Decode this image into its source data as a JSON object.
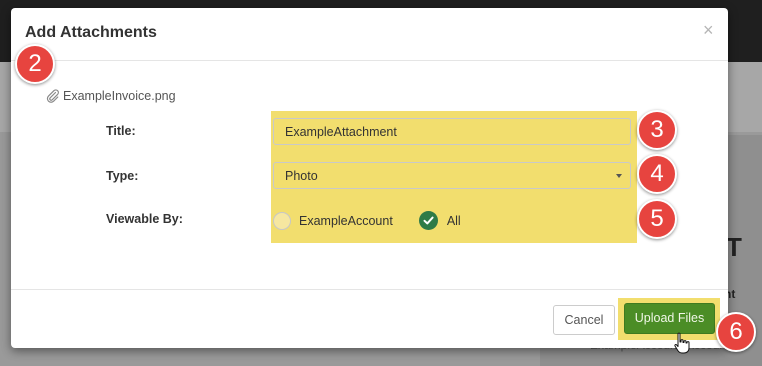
{
  "background": {
    "partial_heading": "T",
    "partial_label": "nt",
    "partial_text": "ExampleAccount, Account"
  },
  "dialog": {
    "title": "Add Attachments",
    "close_glyph": "×",
    "attached_file": "ExampleInvoice.png",
    "fields": {
      "title_label": "Title:",
      "title_value": "ExampleAttachment",
      "type_label": "Type:",
      "type_value": "Photo",
      "viewable_label": "Viewable By:",
      "viewable_options": [
        {
          "label": "ExampleAccount",
          "checked": false
        },
        {
          "label": "All",
          "checked": true
        }
      ]
    },
    "buttons": {
      "cancel": "Cancel",
      "upload": "Upload Files"
    }
  },
  "callouts": [
    "2",
    "3",
    "4",
    "5",
    "6"
  ],
  "colors": {
    "highlight": "#f2de6e",
    "primary_button": "#4b8d26",
    "checked_radio": "#2e7b47",
    "callout": "#e7443f"
  },
  "icons": {
    "attachment": "paperclip-icon",
    "close": "close-icon",
    "dropdown": "caret-down-icon",
    "check": "check-icon",
    "pointer": "hand-pointer-icon"
  }
}
